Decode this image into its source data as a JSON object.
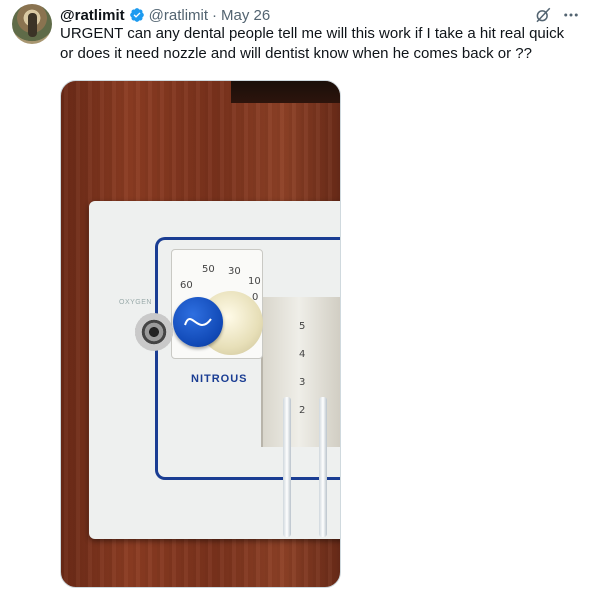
{
  "tweet": {
    "display_name": "@ratlimit",
    "handle": "@ratlimit",
    "separator": "·",
    "date": "May 26",
    "text": "URGENT can any dental people tell me will this work if I take a hit real quick or does it need nozzle and will dentist know when he comes back or ??",
    "verified": true
  },
  "icons": {
    "avatar": "user-avatar",
    "verified": "verified-badge-icon",
    "grok": "grok-icon",
    "more": "more-options-icon"
  },
  "media": {
    "dial_ticks": [
      "50",
      "30",
      "10",
      "0",
      "60"
    ],
    "flowmeter_scale": [
      "5",
      "4",
      "3",
      "2"
    ],
    "panel_label_oxygen": "OXYGEN",
    "panel_label_nitrous": "NITROUS"
  },
  "colors": {
    "verified_blue": "#1d9bf0",
    "text": "#0f1419",
    "secondary_text": "#536471",
    "panel_blue": "#1a3d93"
  }
}
